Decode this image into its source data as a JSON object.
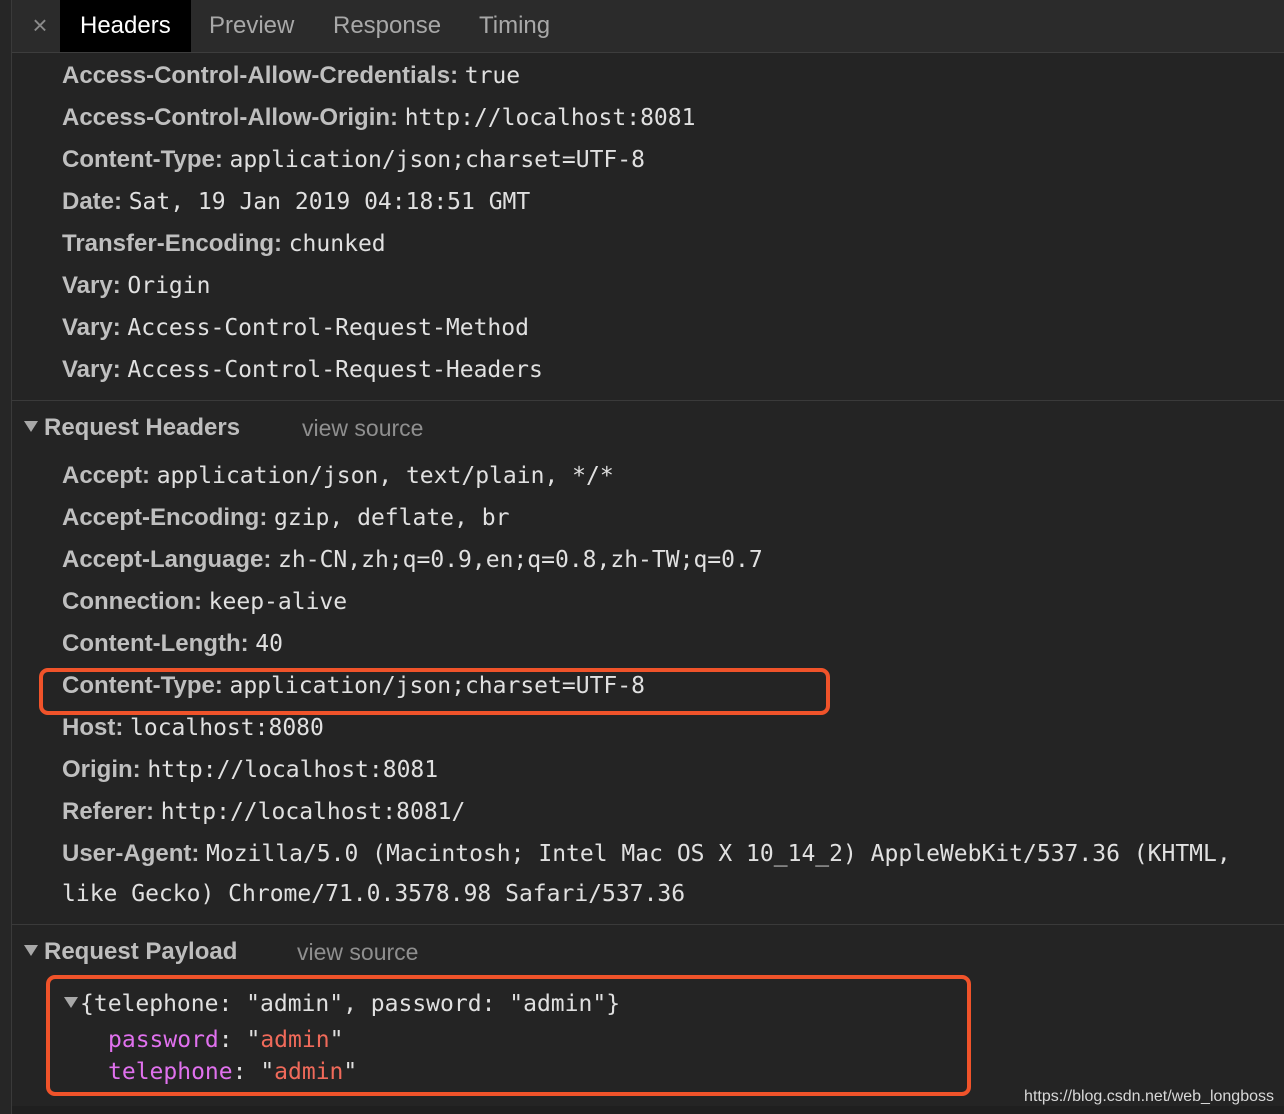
{
  "tabs": {
    "close_icon": "×",
    "headers": "Headers",
    "preview": "Preview",
    "response": "Response",
    "timing": "Timing"
  },
  "response_headers": [
    {
      "name": "Access-Control-Allow-Credentials:",
      "value": "true"
    },
    {
      "name": "Access-Control-Allow-Origin:",
      "value": "http://localhost:8081"
    },
    {
      "name": "Content-Type:",
      "value": "application/json;charset=UTF-8"
    },
    {
      "name": "Date:",
      "value": "Sat, 19 Jan 2019 04:18:51 GMT"
    },
    {
      "name": "Transfer-Encoding:",
      "value": "chunked"
    },
    {
      "name": "Vary:",
      "value": "Origin"
    },
    {
      "name": "Vary:",
      "value": "Access-Control-Request-Method"
    },
    {
      "name": "Vary:",
      "value": "Access-Control-Request-Headers"
    }
  ],
  "request_headers": {
    "title": "Request Headers",
    "view_source": "view source",
    "items": [
      {
        "name": "Accept:",
        "value": "application/json, text/plain, */*"
      },
      {
        "name": "Accept-Encoding:",
        "value": "gzip, deflate, br"
      },
      {
        "name": "Accept-Language:",
        "value": "zh-CN,zh;q=0.9,en;q=0.8,zh-TW;q=0.7"
      },
      {
        "name": "Connection:",
        "value": "keep-alive"
      },
      {
        "name": "Content-Length:",
        "value": "40"
      },
      {
        "name": "Content-Type:",
        "value": "application/json;charset=UTF-8"
      },
      {
        "name": "Host:",
        "value": "localhost:8080"
      },
      {
        "name": "Origin:",
        "value": "http://localhost:8081"
      },
      {
        "name": "Referer:",
        "value": "http://localhost:8081/"
      },
      {
        "name": "User-Agent:",
        "value": "Mozilla/5.0 (Macintosh; Intel Mac OS X 10_14_2) AppleWebKit/537.36 (KHTML,"
      }
    ],
    "user_agent_cont": "like Gecko) Chrome/71.0.3578.98 Safari/537.36"
  },
  "request_payload": {
    "title": "Request Payload",
    "view_source": "view source",
    "summary": "{telephone: \"admin\", password: \"admin\"}",
    "fields": [
      {
        "key": "password",
        "value": "admin"
      },
      {
        "key": "telephone",
        "value": "admin"
      }
    ]
  },
  "watermark": "https://blog.csdn.net/web_longboss",
  "colors": {
    "highlight": "#f0532a",
    "key": "#e071ee",
    "string": "#f06a5a"
  }
}
